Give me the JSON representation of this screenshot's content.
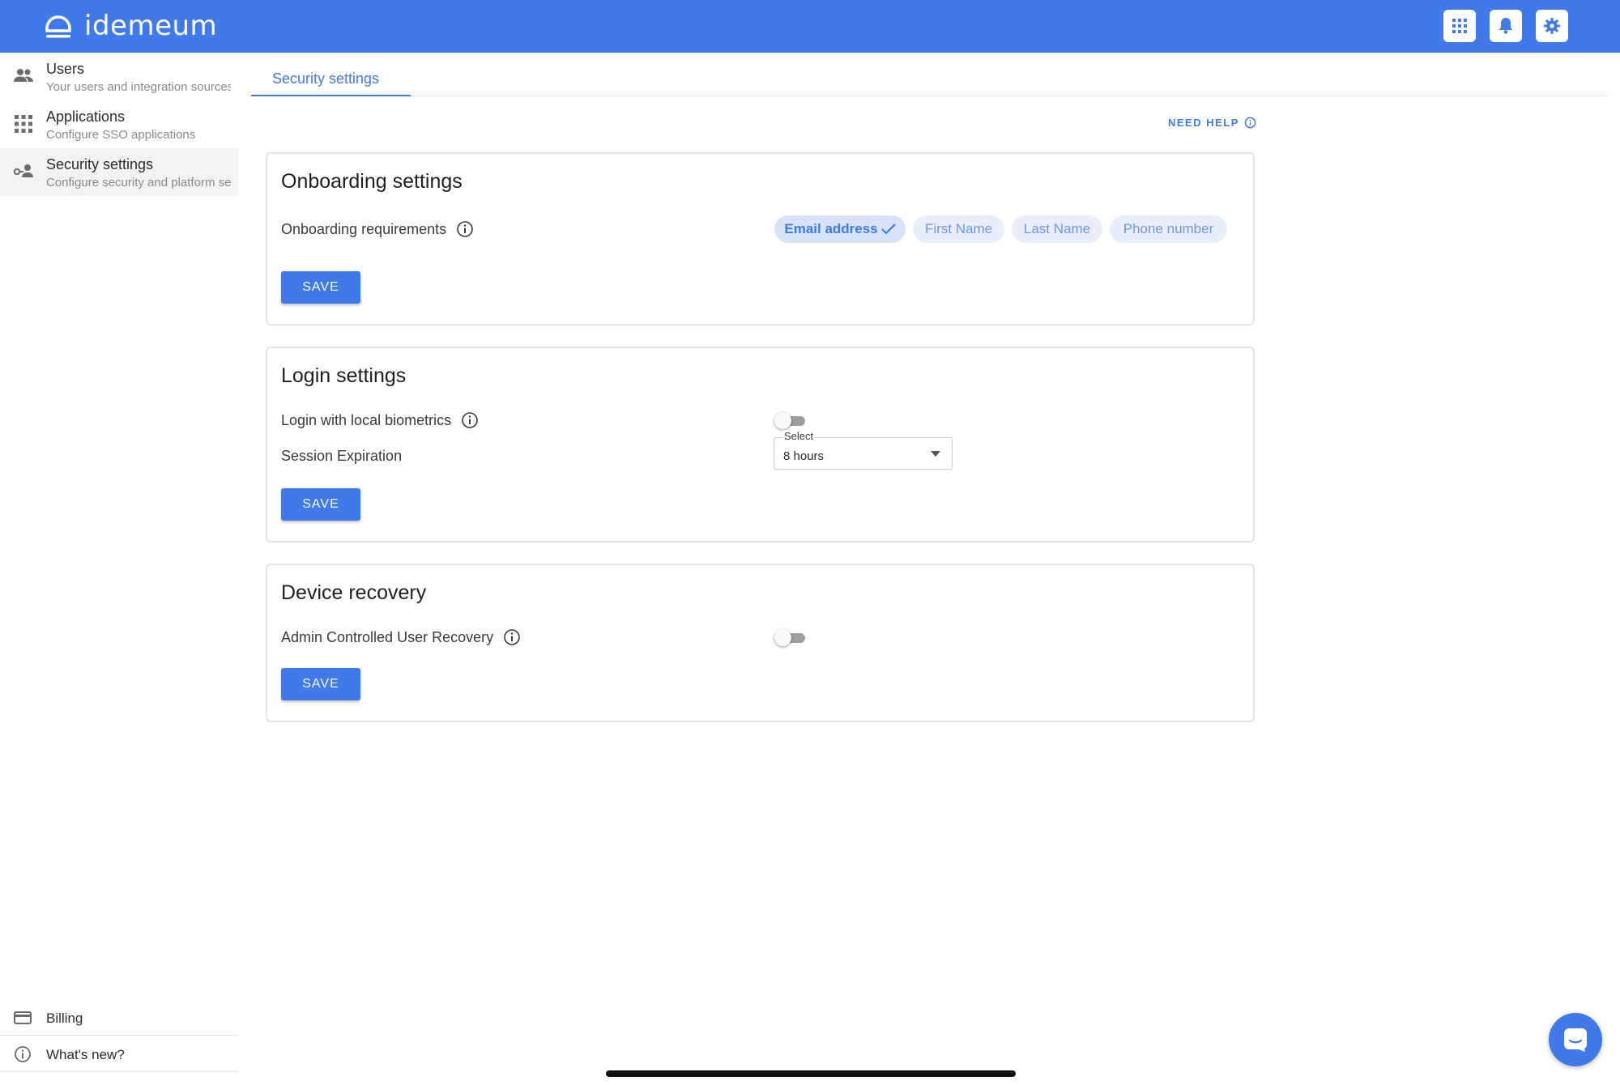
{
  "brand": {
    "name": "idemeum",
    "color": "#3f79ea"
  },
  "header": {
    "buttons": [
      {
        "icon": "apps-grid-icon"
      },
      {
        "icon": "bell-icon"
      },
      {
        "icon": "gear-icon"
      }
    ]
  },
  "sidebar": {
    "items": [
      {
        "title": "Users",
        "subtitle": "Your users and integration sources",
        "icon": "users-icon"
      },
      {
        "title": "Applications",
        "subtitle": "Configure SSO applications",
        "icon": "apps-grid-icon"
      },
      {
        "title": "Security settings",
        "subtitle": "Configure security and platform settings",
        "icon": "security-key-icon",
        "active": true
      }
    ],
    "bottom": [
      {
        "label": "Billing",
        "icon": "credit-card-icon"
      },
      {
        "label": "What's new?",
        "icon": "info-icon"
      }
    ]
  },
  "tabs": [
    {
      "label": "Security settings",
      "active": true
    }
  ],
  "help": {
    "label": "NEED HELP"
  },
  "onboarding": {
    "title": "Onboarding settings",
    "requirements_label": "Onboarding requirements",
    "chips": [
      {
        "label": "Email address",
        "selected": true
      },
      {
        "label": "First Name",
        "selected": false
      },
      {
        "label": "Last Name",
        "selected": false
      },
      {
        "label": "Phone number",
        "selected": false
      }
    ],
    "save_label": "SAVE"
  },
  "login": {
    "title": "Login settings",
    "biometrics_label": "Login with local biometrics",
    "biometrics_enabled": false,
    "session_label": "Session Expiration",
    "session_select_label": "Select",
    "session_value": "8 hours",
    "save_label": "SAVE"
  },
  "recovery": {
    "title": "Device recovery",
    "admin_recovery_label": "Admin Controlled User Recovery",
    "admin_recovery_enabled": false,
    "save_label": "SAVE"
  }
}
